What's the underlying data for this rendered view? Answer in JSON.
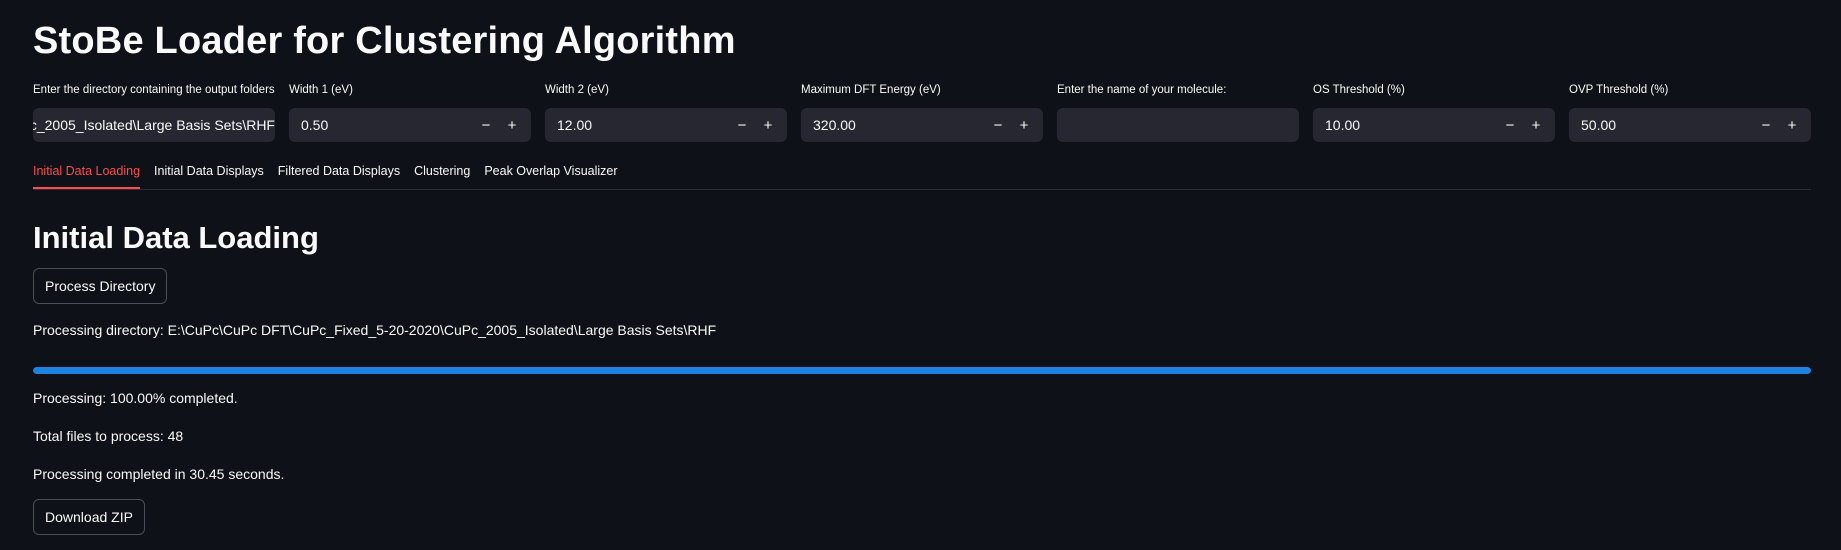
{
  "app": {
    "title": "StoBe Loader for Clustering Algorithm"
  },
  "inputs": {
    "directory": {
      "label": "Enter the directory containing the output folders:",
      "value": "E:\\CuPc\\CuPc DFT\\CuPc_Fixed_5-20-2020\\CuPc_2005_Isolated\\Large Basis Sets\\RHF"
    },
    "width1": {
      "label": "Width 1 (eV)",
      "value": "0.50"
    },
    "width2": {
      "label": "Width 2 (eV)",
      "value": "12.00"
    },
    "max_dft_energy": {
      "label": "Maximum DFT Energy (eV)",
      "value": "320.00"
    },
    "molecule": {
      "label": "Enter the name of your molecule:",
      "value": ""
    },
    "os_threshold": {
      "label": "OS Threshold (%)",
      "value": "10.00"
    },
    "ovp_threshold": {
      "label": "OVP Threshold (%)",
      "value": "50.00"
    },
    "minus_glyph": "−",
    "plus_glyph": "+"
  },
  "tabs": [
    {
      "label": "Initial Data Loading",
      "active": true
    },
    {
      "label": "Initial Data Displays",
      "active": false
    },
    {
      "label": "Filtered Data Displays",
      "active": false
    },
    {
      "label": "Clustering",
      "active": false
    },
    {
      "label": "Peak Overlap Visualizer",
      "active": false
    }
  ],
  "main": {
    "heading": "Initial Data Loading",
    "process_button": "Process Directory",
    "processing_directory": "Processing directory: E:\\CuPc\\CuPc DFT\\CuPc_Fixed_5-20-2020\\CuPc_2005_Isolated\\Large Basis Sets\\RHF",
    "progress_fraction": 1.0,
    "progress_text": "Processing: 100.00% completed.",
    "total_files": "Total files to process: 48",
    "completed_text": "Processing completed in 30.45 seconds.",
    "download_button": "Download ZIP"
  },
  "colors": {
    "background": "#0e1117",
    "input_bg": "#262730",
    "accent_red": "#ff4b4b",
    "progress_blue": "#1c83e1"
  }
}
